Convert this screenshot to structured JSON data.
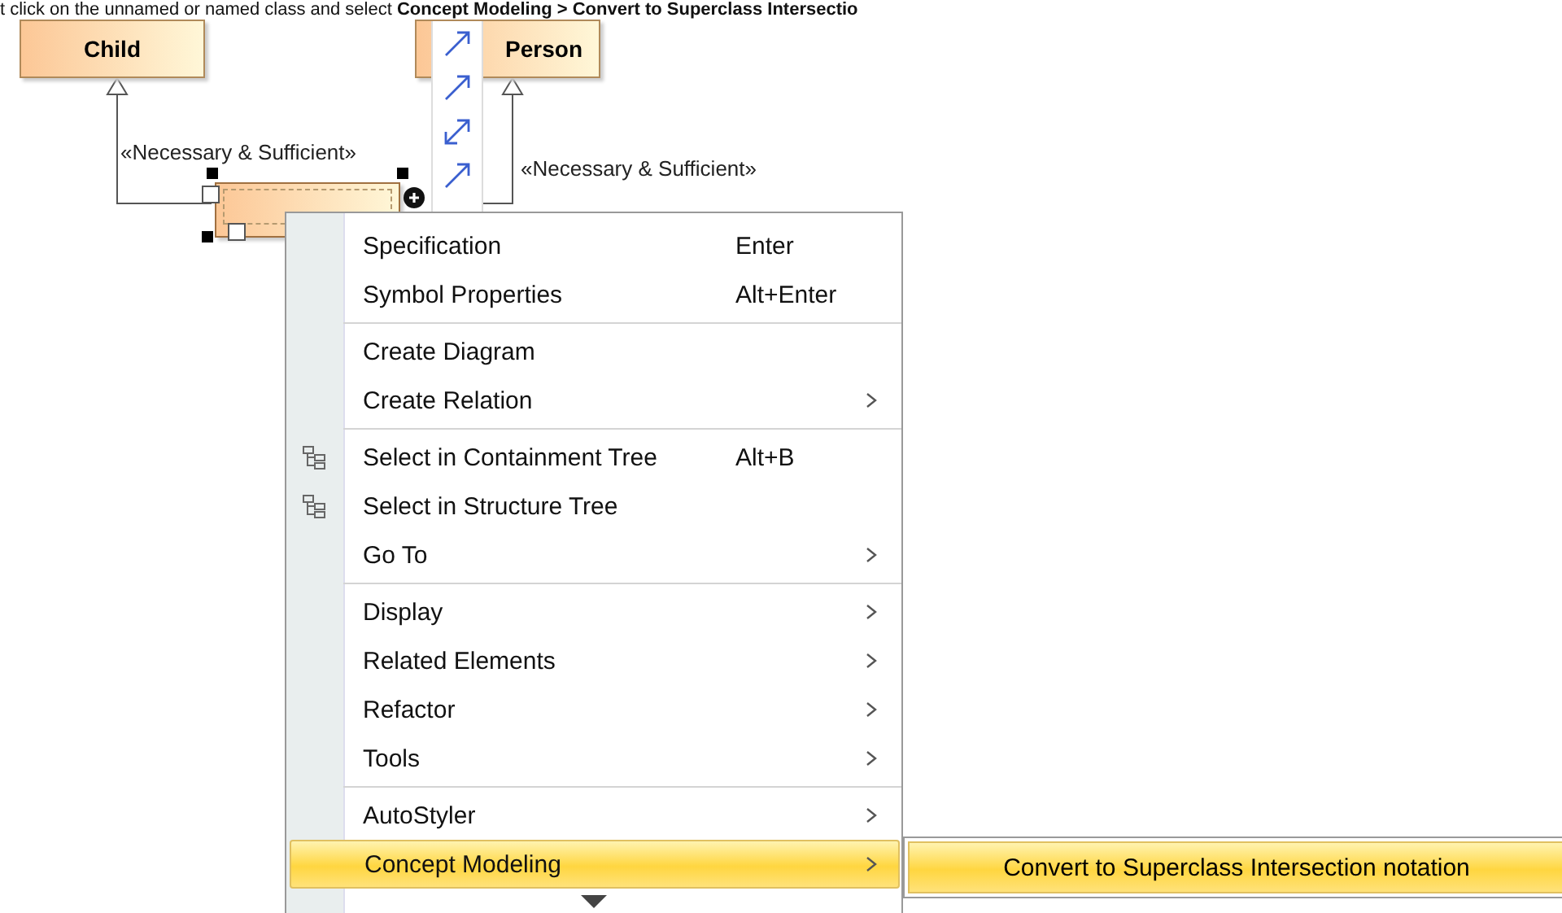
{
  "instruction": "t click on the unnamed or named class and select **Concept Modeling > Convert to Superclass Intersectio**",
  "diagram": {
    "classes": [
      {
        "name": "Child",
        "selected": false
      },
      {
        "name": "Person",
        "selected": false
      },
      {
        "selected": true
      }
    ],
    "labels": [
      "«Necessary & Sufficient»",
      "«Necessary & Sufficient»"
    ]
  },
  "context_menu": {
    "items": [
      {
        "kind": "item",
        "label": "Specification",
        "shortcut": "Enter",
        "submenu": false,
        "has_icon": false,
        "selected": false
      },
      {
        "kind": "item",
        "label": "Symbol Properties",
        "shortcut": "Alt+Enter",
        "submenu": false,
        "has_icon": false,
        "selected": false
      },
      {
        "kind": "separator"
      },
      {
        "kind": "item",
        "label": "Create Diagram",
        "submenu": false,
        "has_icon": false,
        "selected": false
      },
      {
        "kind": "item",
        "label": "Create Relation",
        "submenu": true,
        "has_icon": false,
        "selected": false
      },
      {
        "kind": "separator"
      },
      {
        "kind": "item",
        "label": "Select in Containment Tree",
        "shortcut": "Alt+B",
        "submenu": false,
        "has_icon": true,
        "selected": false
      },
      {
        "kind": "item",
        "label": "Select in Structure Tree",
        "submenu": false,
        "has_icon": true,
        "selected": false
      },
      {
        "kind": "item",
        "label": "Go To",
        "submenu": true,
        "has_icon": false,
        "selected": false
      },
      {
        "kind": "separator"
      },
      {
        "kind": "item",
        "label": "Display",
        "submenu": true,
        "has_icon": false,
        "selected": false
      },
      {
        "kind": "item",
        "label": "Related Elements",
        "submenu": true,
        "has_icon": false,
        "selected": false
      },
      {
        "kind": "item",
        "label": "Refactor",
        "submenu": true,
        "has_icon": false,
        "selected": false
      },
      {
        "kind": "item",
        "label": "Tools",
        "submenu": true,
        "has_icon": false,
        "selected": false
      },
      {
        "kind": "separator"
      },
      {
        "kind": "item",
        "label": "AutoStyler",
        "submenu": true,
        "has_icon": false,
        "selected": false
      },
      {
        "kind": "item",
        "label": "Concept Modeling",
        "submenu": true,
        "has_icon": false,
        "selected": true
      },
      {
        "kind": "scroll-down"
      }
    ]
  },
  "submenu": {
    "items": [
      {
        "label": "Convert to Superclass Intersection notation",
        "selected": true
      }
    ]
  }
}
